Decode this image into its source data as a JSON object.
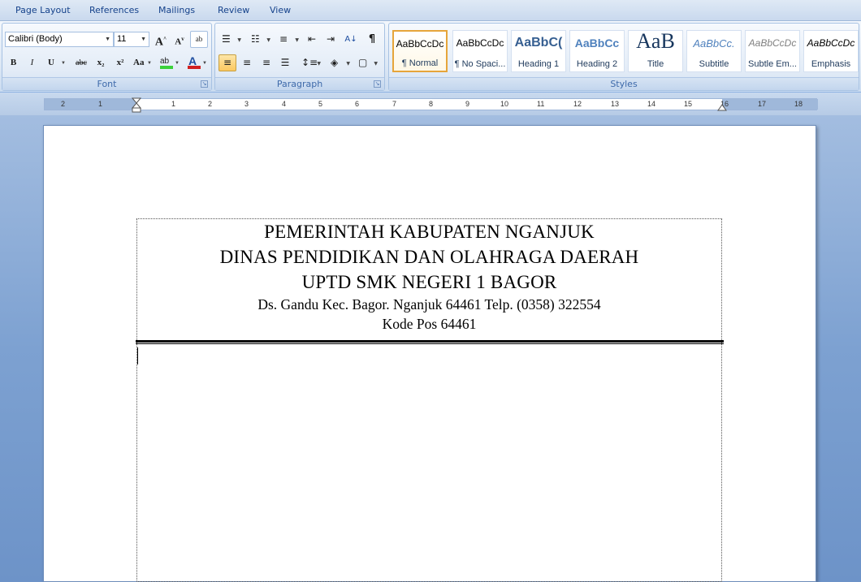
{
  "tabs": [
    "Page Layout",
    "References",
    "Mailings",
    "Review",
    "View"
  ],
  "font_group": {
    "label": "Font",
    "font_name": "Calibri (Body)",
    "font_size": "11",
    "grow_label": "A",
    "shrink_label": "A",
    "bold": "B",
    "italic": "I",
    "underline": "U",
    "strike": "abc",
    "subscript": "x₂",
    "superscript": "x²",
    "change_case": "Aa",
    "font_color": "A",
    "highlight": "ab"
  },
  "paragraph_group": {
    "label": "Paragraph",
    "pilcrow": "¶"
  },
  "styles_group": {
    "label": "Styles",
    "items": [
      {
        "sample": "AaBbCcDc",
        "name": "¶ Normal"
      },
      {
        "sample": "AaBbCcDc",
        "name": "¶ No Spaci..."
      },
      {
        "sample": "AaBbC(",
        "name": "Heading 1"
      },
      {
        "sample": "AaBbCc",
        "name": "Heading 2"
      },
      {
        "sample": "AaB",
        "name": "Title"
      },
      {
        "sample": "AaBbCc.",
        "name": "Subtitle"
      },
      {
        "sample": "AaBbCcDc",
        "name": "Subtle Em..."
      },
      {
        "sample": "AaBbCcDc",
        "name": "Emphasis"
      }
    ]
  },
  "ruler": {
    "left_numbers": [
      "2",
      "1"
    ],
    "numbers": [
      "1",
      "2",
      "3",
      "4",
      "5",
      "6",
      "7",
      "8",
      "9",
      "10",
      "11",
      "12",
      "13",
      "14",
      "15",
      "16",
      "17",
      "18"
    ]
  },
  "document": {
    "line1": "PEMERINTAH KABUPATEN NGANJUK",
    "line2": "DINAS PENDIDIKAN DAN OLAHRAGA DAERAH",
    "line3": "UPTD SMK NEGERI 1 BAGOR",
    "line4": "Ds. Gandu Kec. Bagor. Nganjuk 64461 Telp. (0358) 322554",
    "line5": "Kode Pos 64461"
  },
  "colors": {
    "accent": "#e6a53a",
    "ribbon_text": "#1e395b",
    "link_blue": "#15428b"
  }
}
